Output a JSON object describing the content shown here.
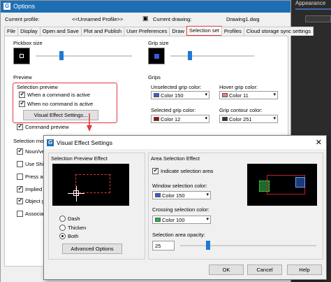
{
  "background": {
    "right_tab": "Appearance",
    "right_color": "#2b2b2b"
  },
  "options": {
    "title": "Options",
    "profile_label": "Current profile:",
    "profile_value": "<<Unnamed Profile>>",
    "drawing_label": "Current drawing:",
    "drawing_value": "Drawing1.dwg",
    "tabs": [
      "File",
      "Display",
      "Open and Save",
      "Plot and Publish",
      "User Preferences",
      "Draw",
      "Selection set",
      "Profiles",
      "Cloud storage sync settings"
    ],
    "selected_tab": "Selection set",
    "pickbox_size": "Pickbox size",
    "grip_size": "Grip size",
    "preview": "Preview",
    "selection_preview": "Selection preview",
    "when_command_active": "When a command is active",
    "when_no_command_active": "When no command is active",
    "visual_effect_settings_btn": "Visual Effect Settings...",
    "command_preview": "Command preview",
    "selection_modes_partial": "Selection mo",
    "selection_modes_items": [
      "Noun/ver",
      "Use Shif",
      "Press an",
      "Implied w",
      "Object gr",
      "Associat"
    ],
    "selection_modes_checked": [
      true,
      false,
      false,
      true,
      true,
      false
    ],
    "grips": "Grips",
    "unselected_grip_color": "Unselected grip color:",
    "unselected_grip_value": "Color 150",
    "hover_grip_color": "Hover grip color:",
    "hover_grip_value": "Color 11",
    "selected_grip_color": "Selected grip color:",
    "selected_grip_value": "Color 12",
    "grip_contour_color": "Grip contour color:",
    "grip_contour_value": "Color 251",
    "colors": {
      "c150": "#3b5bd6",
      "c11": "#f08080",
      "c12": "#9b1010",
      "c251": "#333333",
      "c100": "#1fb83e",
      "accent": "#e0393e",
      "slider": "#1e7ad2"
    }
  },
  "visual_effect": {
    "title": "Visual Effect Settings",
    "close_glyph": "✕",
    "selection_preview_effect": "Selection Preview Effect",
    "dash": "Dash",
    "thicken": "Thicken",
    "both": "Both",
    "selected_effect": "Both",
    "advanced_options": "Advanced Options",
    "area_selection_effect": "Area Selection Effect",
    "indicate_selection_area": "Indicate selection area",
    "window_selection_color": "Window selection color:",
    "window_selection_value": "Color 150",
    "crossing_selection_color": "Crossing selection color:",
    "crossing_selection_value": "Color 100",
    "selection_area_opacity": "Selection area opacity:",
    "opacity_value": "25",
    "opacity_level_pct": 25,
    "ok": "OK",
    "cancel": "Cancel",
    "help": "Help"
  }
}
